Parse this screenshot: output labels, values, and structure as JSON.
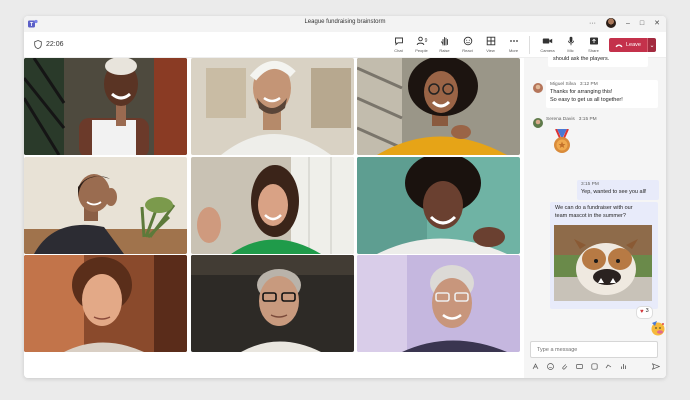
{
  "window": {
    "title": "League fundraising brainstorm"
  },
  "titlebar": {
    "more": "···",
    "minimize": "–",
    "maximize": "□",
    "close": "✕"
  },
  "toolbar": {
    "timer": "22:06",
    "tools": [
      {
        "label": "Chat",
        "icon": "chat-icon"
      },
      {
        "label": "People",
        "icon": "people-icon",
        "badge": "9"
      },
      {
        "label": "Raise",
        "icon": "raise-hand-icon"
      },
      {
        "label": "React",
        "icon": "react-icon"
      },
      {
        "label": "View",
        "icon": "view-icon"
      },
      {
        "label": "More",
        "icon": "more-icon"
      },
      {
        "label": "Camera",
        "icon": "camera-icon"
      },
      {
        "label": "Mic",
        "icon": "mic-icon"
      },
      {
        "label": "Share",
        "icon": "share-icon"
      }
    ],
    "leave_label": "Leave",
    "leave_color": "#c4314b"
  },
  "chat": {
    "truncated_text": "should ask the players.",
    "msg1": {
      "sender": "Miguel Silva",
      "time": "3:12 PM",
      "lines": [
        "Thanks for arranging this!",
        "So easy to get us all together!"
      ]
    },
    "msg2": {
      "sender": "Serena Davis",
      "time": "3:15 PM",
      "emoji": "medal"
    },
    "mine": {
      "time": "3:15 PM",
      "line1": "Yep, wanted to see you all!",
      "line2a": "We can do a fundraiser with our",
      "line2b": "team mascot in the summer?",
      "reaction_count": "3"
    },
    "compose_placeholder": "Type a message",
    "accent": "#e8ebfa"
  }
}
